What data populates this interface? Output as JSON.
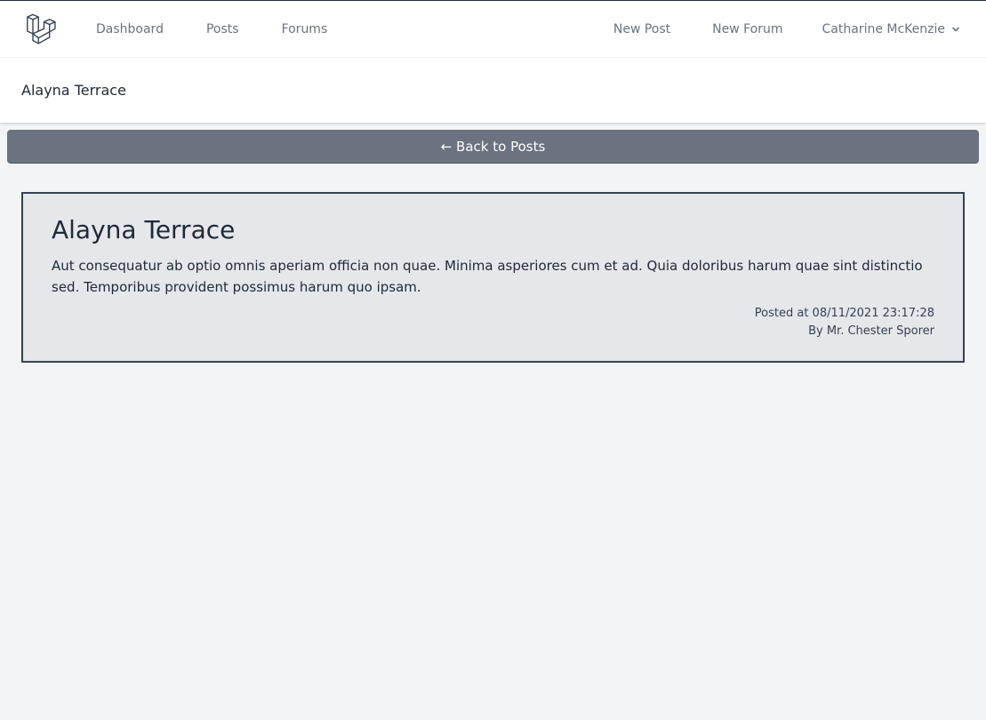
{
  "nav": {
    "links": [
      "Dashboard",
      "Posts",
      "Forums"
    ],
    "right_links": [
      "New Post",
      "New Forum"
    ],
    "user_name": "Catharine McKenzie"
  },
  "header": {
    "title": "Alayna Terrace"
  },
  "back_button": {
    "label": "← Back to Posts"
  },
  "post": {
    "title": "Alayna Terrace",
    "body": "Aut consequatur ab optio omnis aperiam officia non quae. Minima asperiores cum et ad. Quia doloribus harum quae sint distinctio sed. Temporibus provident possimus harum quo ipsam.",
    "posted_at": "Posted at 08/11/2021 23:17:28",
    "author": "By Mr. Chester Sporer"
  },
  "icons": {
    "logo": "laravel-logo-icon",
    "chevron": "chevron-down-icon"
  },
  "colors": {
    "back_button_bg": "#6b7280",
    "card_bg": "#e5e7eb",
    "card_border": "#374151"
  }
}
